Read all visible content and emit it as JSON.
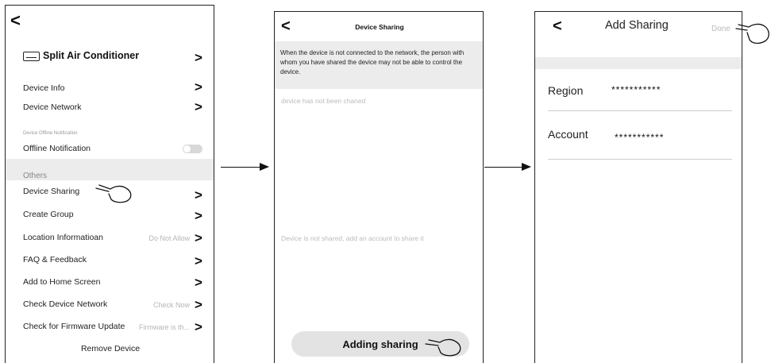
{
  "screen1": {
    "back_label": "<",
    "device_title": "Split Air Conditioner",
    "chevron": ">",
    "device_info": "Device Info",
    "device_network": "Device Network",
    "offline_section_label": "Device Offline Notification",
    "offline_notification": "Offline  Notification",
    "others_label": "Others",
    "device_sharing": "Device Sharing",
    "create_group": "Create Group",
    "location_info": "Location Informatioan",
    "location_value": "Do Not Allow",
    "faq": "FAQ & Feedback",
    "add_home": "Add to Home Screen",
    "check_network": "Check Device Network",
    "check_network_value": "Check Now",
    "check_firmware": "Check for Firmware Update",
    "check_firmware_value": "Firmware is th...",
    "remove_device": "Remove Device"
  },
  "screen2": {
    "back_label": "<",
    "title": "Device Sharing",
    "notice": "When the device is not connected to the network, the person with whom you have shared the device may not be able to control the device.",
    "not_changed": "device has not been chaned",
    "empty_message": "Device is not shared, add an account to share it",
    "add_button": "Adding sharing"
  },
  "screen3": {
    "back_label": "<",
    "title": "Add Sharing",
    "done": "Done",
    "region_label": "Region",
    "region_value": "***********",
    "account_label": "Account",
    "account_value": "***********"
  },
  "colors": {
    "gray_band": "#ececec",
    "toggle_off": "#d8d8d8",
    "muted_text": "#b5b5b5"
  }
}
